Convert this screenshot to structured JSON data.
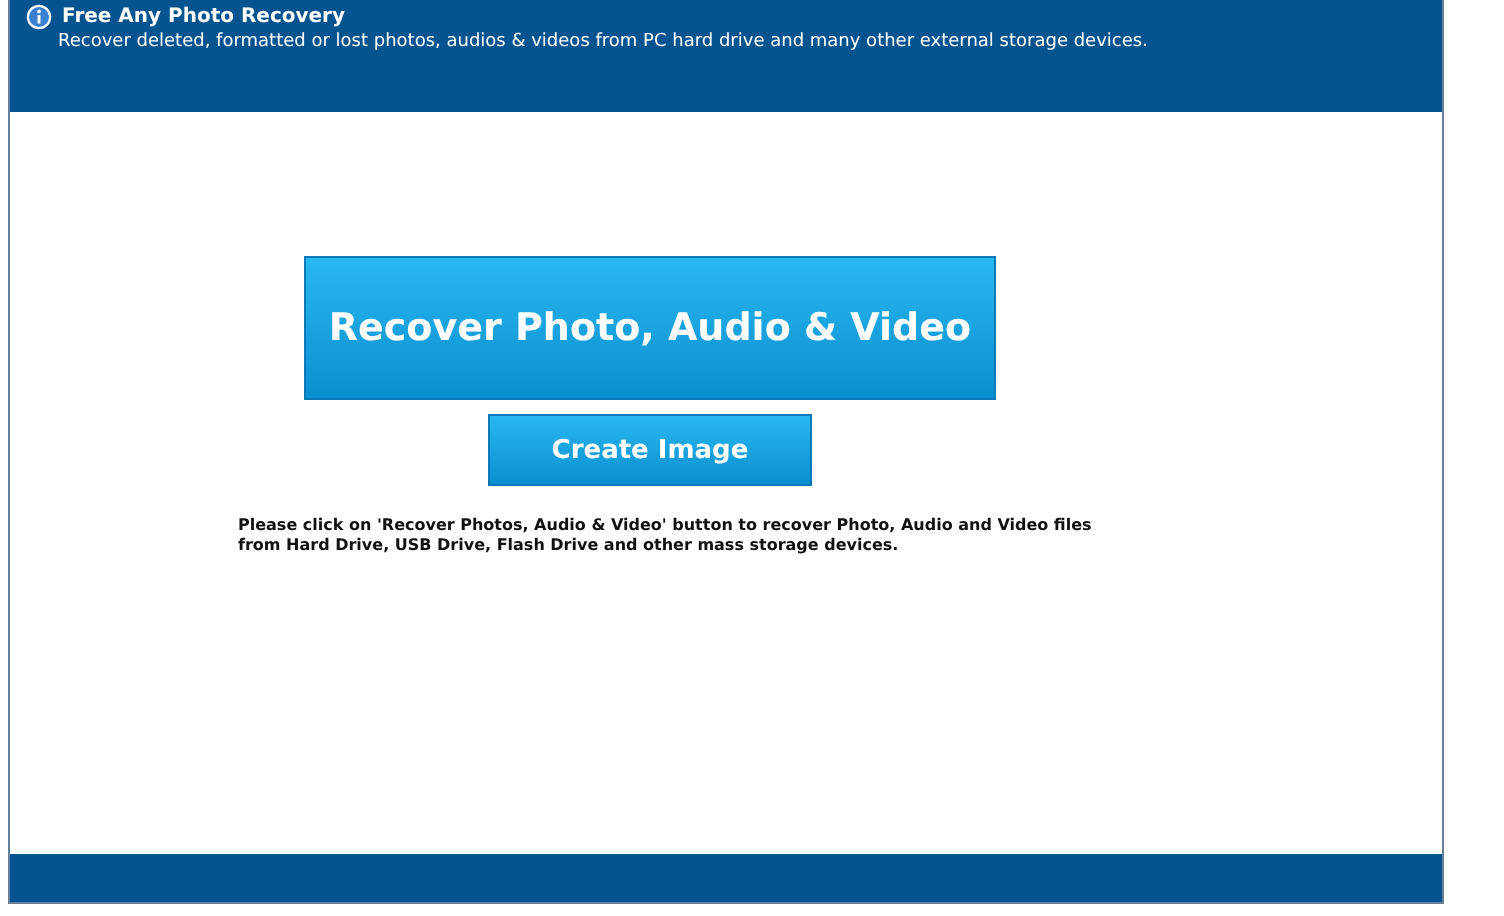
{
  "header": {
    "title": "Free Any Photo Recovery",
    "subtitle": "Recover deleted, formatted or lost photos, audios & videos from PC hard drive and many other external storage devices."
  },
  "buttons": [
    {
      "label": "Recover Photo, Audio & Video",
      "kind": "primary"
    },
    {
      "label": "Create Image",
      "kind": "secondary"
    }
  ],
  "instructions": "Please click on 'Recover Photos, Audio & Video' button to recover Photo, Audio and Video files from Hard Drive, USB Drive, Flash Drive and other mass storage devices."
}
